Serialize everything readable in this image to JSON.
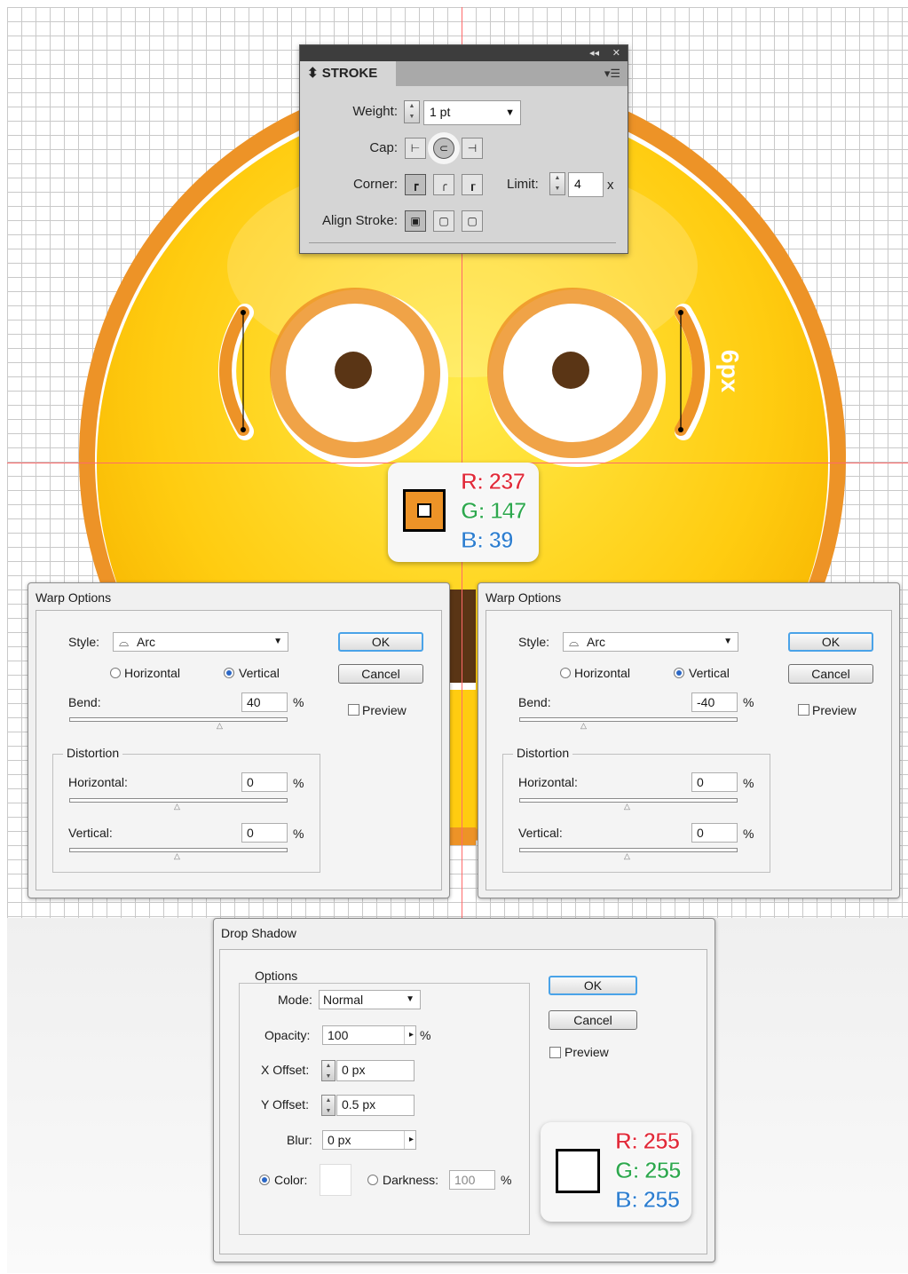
{
  "canvas": {
    "measure_label": "6px"
  },
  "stroke_panel": {
    "title": "STROKE",
    "weight_label": "Weight:",
    "weight_value": "1 pt",
    "cap_label": "Cap:",
    "corner_label": "Corner:",
    "limit_label": "Limit:",
    "limit_value": "4",
    "limit_unit": "x",
    "align_label": "Align Stroke:"
  },
  "color_top": {
    "r": "R: 237",
    "g": "G: 147",
    "b": "B: 39",
    "swatch": "#ed9327"
  },
  "warp_left": {
    "title": "Warp Options",
    "style_label": "Style:",
    "style_value": "Arc",
    "horizontal_label": "Horizontal",
    "vertical_label": "Vertical",
    "orientation": "Vertical",
    "bend_label": "Bend:",
    "bend_value": "40",
    "percent": "%",
    "distortion_label": "Distortion",
    "dist_h_label": "Horizontal:",
    "dist_h_value": "0",
    "dist_v_label": "Vertical:",
    "dist_v_value": "0",
    "ok": "OK",
    "cancel": "Cancel",
    "preview": "Preview"
  },
  "warp_right": {
    "title": "Warp Options",
    "style_label": "Style:",
    "style_value": "Arc",
    "horizontal_label": "Horizontal",
    "vertical_label": "Vertical",
    "orientation": "Vertical",
    "bend_label": "Bend:",
    "bend_value": "-40",
    "percent": "%",
    "distortion_label": "Distortion",
    "dist_h_label": "Horizontal:",
    "dist_h_value": "0",
    "dist_v_label": "Vertical:",
    "dist_v_value": "0",
    "ok": "OK",
    "cancel": "Cancel",
    "preview": "Preview"
  },
  "drop_shadow": {
    "title": "Drop Shadow",
    "options_label": "Options",
    "mode_label": "Mode:",
    "mode_value": "Normal",
    "opacity_label": "Opacity:",
    "opacity_value": "100",
    "percent": "%",
    "x_offset_label": "X Offset:",
    "x_offset_value": "0 px",
    "y_offset_label": "Y Offset:",
    "y_offset_value": "0.5 px",
    "blur_label": "Blur:",
    "blur_value": "0 px",
    "color_label": "Color:",
    "darkness_label": "Darkness:",
    "darkness_value": "100",
    "ok": "OK",
    "cancel": "Cancel",
    "preview": "Preview"
  },
  "color_bottom": {
    "r": "R: 255",
    "g": "G: 255",
    "b": "B: 255",
    "swatch": "#ffffff"
  }
}
